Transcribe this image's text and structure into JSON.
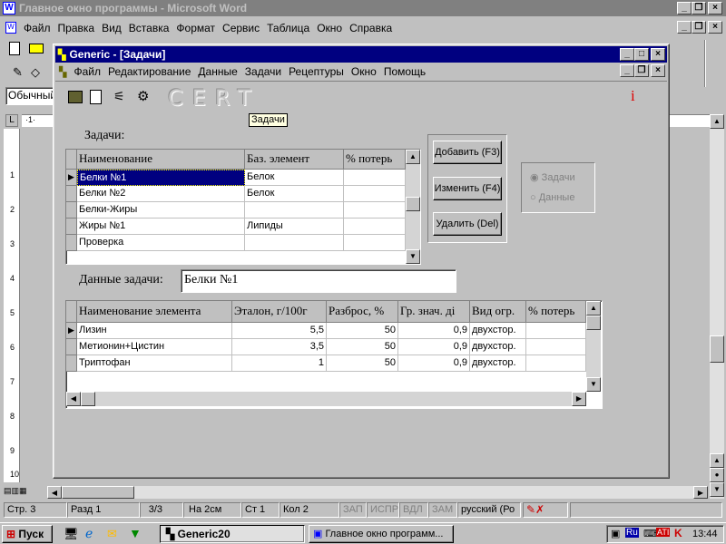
{
  "word": {
    "title": "Главное окно программы - Microsoft Word",
    "menu": [
      "Файл",
      "Правка",
      "Вид",
      "Вставка",
      "Формат",
      "Сервис",
      "Таблица",
      "Окно",
      "Справка"
    ],
    "style_box": "Обычный",
    "status": {
      "page": "Стр. 3",
      "section": "Разд 1",
      "pages": "3/3",
      "at": "На 2см",
      "line": "Ст 1",
      "col": "Кол 2",
      "rec": "ЗАП",
      "trk": "ИСПР",
      "ext": "ВДЛ",
      "ovr": "ЗАМ",
      "lang": "русский (Ро"
    }
  },
  "app": {
    "title": "Generic - [Задачи]",
    "menu": [
      "Файл",
      "Редактирование",
      "Данные",
      "Задачи",
      "Рецептуры",
      "Окно",
      "Помощь"
    ],
    "logo": "CERT",
    "info_glyph": "i",
    "tooltip": "Задачи",
    "tasks_label": "Задачи:",
    "tasks_table": {
      "headers": [
        "Наименование",
        "Баз. элемент",
        "% потерь"
      ],
      "rows": [
        [
          "Белки №1",
          "Белок",
          ""
        ],
        [
          "Белки №2",
          "Белок",
          ""
        ],
        [
          "Белки-Жиры",
          "",
          ""
        ],
        [
          "Жиры №1",
          "Липиды",
          ""
        ],
        [
          "Проверка",
          "",
          ""
        ]
      ]
    },
    "buttons": {
      "add": "Добавить (F3)",
      "edit": "Изменить (F4)",
      "delete": "Удалить (Del)"
    },
    "radio": {
      "tasks": "Задачи",
      "data": "Данные"
    },
    "task_data_label": "Данные задачи:",
    "task_data_value": "Белки №1",
    "elements_table": {
      "headers": [
        "Наименование элемента",
        "Эталон, г/100г",
        "Разброс, %",
        "Гр. знач. ді",
        "Вид огр.",
        "% потерь"
      ],
      "rows": [
        [
          "Лизин",
          "5,5",
          "50",
          "0,9",
          "двухстор.",
          ""
        ],
        [
          "Метионин+Цистин",
          "3,5",
          "50",
          "0,9",
          "двухстор.",
          ""
        ],
        [
          "Триптофан",
          "1",
          "50",
          "0,9",
          "двухстор.",
          ""
        ]
      ]
    }
  },
  "taskbar": {
    "start": "Пуск",
    "task1": "Generic20",
    "task2": "Главное окно программ...",
    "clock": "13:44"
  },
  "ruler_numbers": [
    "1",
    "2",
    "3",
    "4",
    "5",
    "6",
    "7",
    "8",
    "9",
    "10"
  ]
}
